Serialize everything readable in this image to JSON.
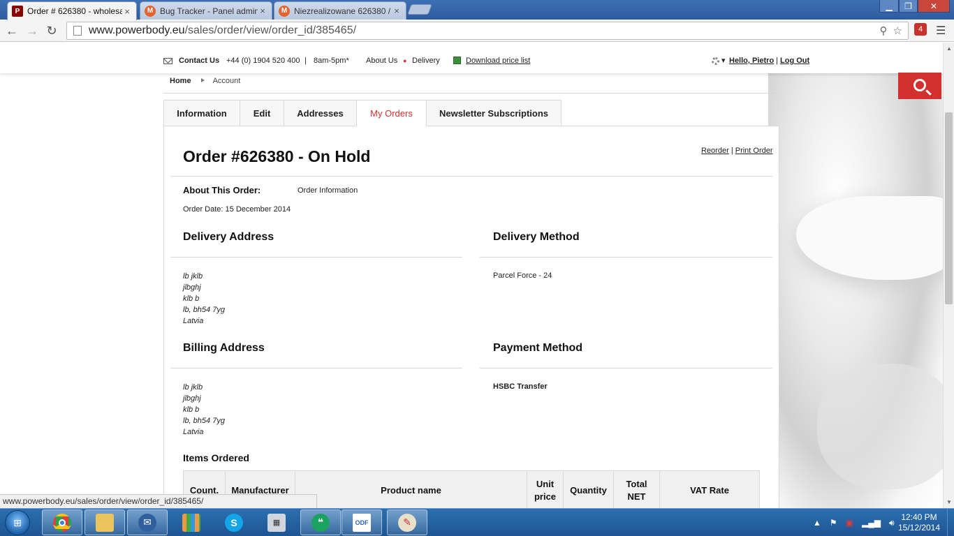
{
  "browser": {
    "tabs": [
      {
        "title": "Order # 626380 - wholesal",
        "favicon": "powerbody-icon",
        "active": true
      },
      {
        "title": "Bug Tracker - Panel admin",
        "favicon": "magento-icon",
        "active": false
      },
      {
        "title": "Niezrealizowane 626380 / I",
        "favicon": "magento-icon",
        "active": false
      }
    ],
    "close_glyph": "×",
    "url_host": "www.powerbody.eu",
    "url_path": "/sales/order/view/order_id/385465/",
    "ext_badge": "4"
  },
  "site_header": {
    "contact_label": "Contact Us",
    "phone": "+44 (0) 1904 520 400",
    "sep": "|",
    "hours": "8am-5pm*",
    "about": "About Us",
    "delivery": "Delivery",
    "price_list": "Download price list",
    "greeting": "Hello, Pietro",
    "logout": "Log Out"
  },
  "breadcrumb": {
    "home": "Home",
    "current": "Account"
  },
  "account_tabs": [
    {
      "label": "Information",
      "active": false
    },
    {
      "label": "Edit",
      "active": false
    },
    {
      "label": "Addresses",
      "active": false
    },
    {
      "label": "My Orders",
      "active": true
    },
    {
      "label": "Newsletter Subscriptions",
      "active": false
    }
  ],
  "order": {
    "title": "Order #626380 - On Hold",
    "reorder": "Reorder",
    "link_sep": "|",
    "print": "Print Order",
    "about_label": "About This Order:",
    "about_link": "Order Information",
    "date": "Order Date: 15 December 2014",
    "delivery_address_title": "Delivery Address",
    "delivery_address": [
      "lb jklb",
      "jlbghj",
      "klb b",
      "lb, bh54 7yg",
      "Latvia"
    ],
    "delivery_method_title": "Delivery Method",
    "delivery_method": "Parcel Force - 24",
    "billing_address_title": "Billing Address",
    "billing_address": [
      "lb jklb",
      "jlbghj",
      "klb b",
      "lb, bh54 7yg",
      "Latvia"
    ],
    "payment_method_title": "Payment Method",
    "payment_method": "HSBC Transfer",
    "items_title": "Items Ordered",
    "columns": [
      "Count.",
      "Manufacturer",
      "Product name",
      "Unit price",
      "Quantity",
      "Total NET",
      "VAT Rate"
    ]
  },
  "status_bar": "www.powerbody.eu/sales/order/view/order_id/385465/",
  "taskbar": {
    "apps": [
      "chrome",
      "explorer",
      "thunderbird",
      "grid-app",
      "skype",
      "calculator",
      "hangouts",
      "odf-document",
      "paint"
    ],
    "time": "12:40 PM",
    "date": "15/12/2014"
  },
  "colors": {
    "accent": "#d32f2f",
    "taskbar": "#1e5593"
  }
}
